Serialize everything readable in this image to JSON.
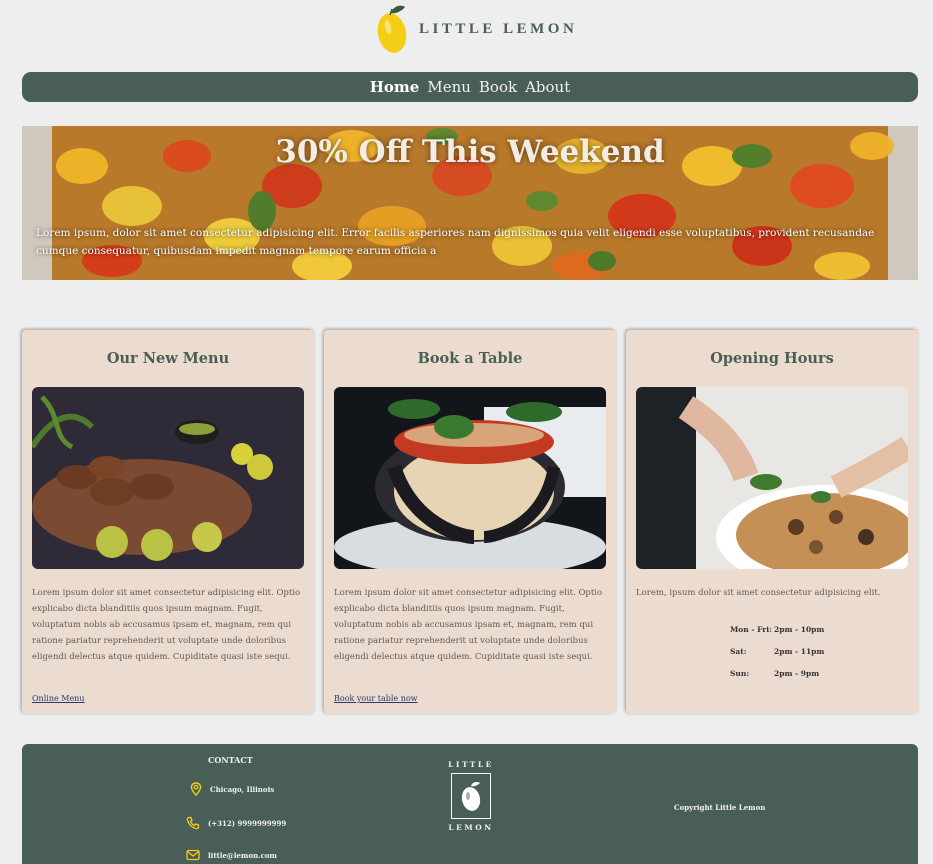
{
  "header": {
    "brand_name": "LITTLE LEMON",
    "logo_icon": "lemon-icon"
  },
  "nav": {
    "items": [
      {
        "label": "Home",
        "active": true
      },
      {
        "label": "Menu",
        "active": false
      },
      {
        "label": "Book",
        "active": false
      },
      {
        "label": "About",
        "active": false
      }
    ]
  },
  "hero": {
    "title": "30% Off This Weekend",
    "text": "Lorem ipsum, dolor sit amet consectetur adipisicing elit. Error facilis asperiores nam dignissimos quia velit eligendi esse voluptatibus, provident recusandae cumque consequatur, quibusdam impedit magnam tempore earum officia a"
  },
  "cards": [
    {
      "title": "Our New Menu",
      "image": "grilled-chicken-with-limes",
      "text": " Lorem ipsum dolor sit amet consectetur adipisicing elit. Optio explicabo dicta blanditiis quos ipsum magnam. Fugit, voluptatum nobis ab accusamus ipsam et, magnam, rem qui ratione pariatur reprehenderit ut voluptate unde doloribus eligendi delectus atque quidem. Cupiditate quasi iste sequi.",
      "link": "Online Menu"
    },
    {
      "title": "Book a Table",
      "image": "eggplant-rollatini",
      "text": " Lorem ipsum dolor sit amet consectetur adipisicing elit. Optio explicabo dicta blanditiis quos ipsum magnam. Fugit, voluptatum nobis ab accusamus ipsam et, magnam, rem qui ratione pariatur reprehenderit ut voluptate unde doloribus eligendi delectus atque quidem. Cupiditate quasi iste sequi.",
      "link": "Book your table now"
    },
    {
      "title": "Opening Hours",
      "image": "chef-garnishing-pizza",
      "text": "Lorem, ipsum dolor sit amet consectetur adipisicing elit.",
      "hours": [
        {
          "day": "Mon - Fri:",
          "time": "2pm - 10pm"
        },
        {
          "day": "Sat:",
          "time": "2pm - 11pm"
        },
        {
          "day": "Sun:",
          "time": "2pm - 9pm"
        }
      ]
    }
  ],
  "footer": {
    "contact_title": "CONTACT",
    "address": "Chicago, Illinois",
    "phone": "(+312) 9999999999",
    "email": "little@lemon.com",
    "logo_top": "LITTLE",
    "logo_bottom": "LEMON",
    "copyright": "Copyright Little Lemon"
  },
  "colors": {
    "primary_green": "#495e57",
    "card_bg": "#ecdccf",
    "page_bg": "#edeeed",
    "accent_yellow": "#f4ce14"
  }
}
